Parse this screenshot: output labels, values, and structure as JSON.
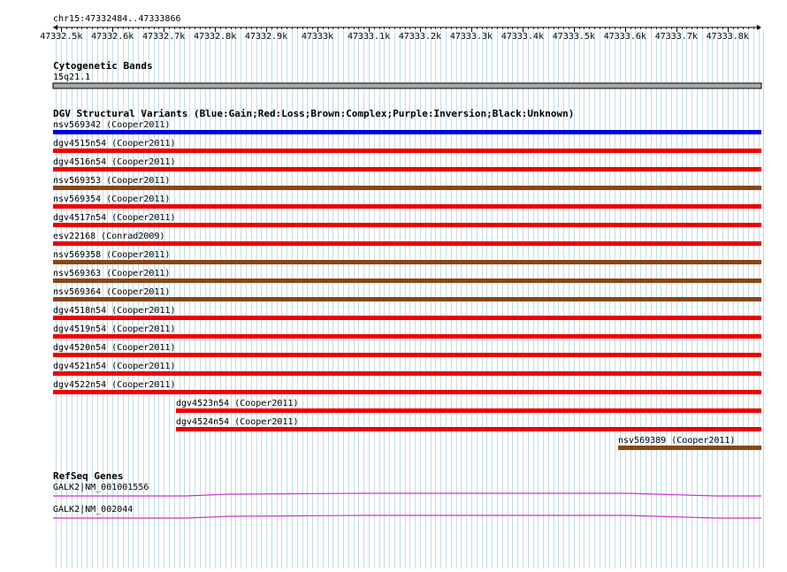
{
  "ruler": {
    "locus": "chr15:47332484..47333866",
    "tick_labels": [
      "47332.5k",
      "47332.6k",
      "47332.7k",
      "47332.8k",
      "47332.9k",
      "47333k",
      "47333.1k",
      "47333.2k",
      "47333.3k",
      "47333.4k",
      "47333.5k",
      "47333.6k",
      "47333.7k",
      "47333.8k"
    ]
  },
  "tracks": {
    "cytoband": {
      "title": "Cytogenetic Bands",
      "band_label": "15q21.1",
      "colors": {
        "band": "#a8a8a8",
        "outline": "#000000"
      }
    },
    "dgv": {
      "title": "DGV Structural Variants (Blue:Gain;Red:Loss;Brown:Complex;Purple:Inversion;Black:Unknown)",
      "colors": {
        "gain": "#0000e0",
        "loss": "#ee0000",
        "complex": "#8b4513"
      },
      "features": [
        {
          "label": "nsv569342 (Cooper2011)",
          "type": "gain",
          "start": 47332484,
          "end": 47333866
        },
        {
          "label": "dgv4515n54 (Cooper2011)",
          "type": "loss",
          "start": 47332484,
          "end": 47333866
        },
        {
          "label": "dgv4516n54 (Cooper2011)",
          "type": "loss",
          "start": 47332484,
          "end": 47333866
        },
        {
          "label": "nsv569353 (Cooper2011)",
          "type": "complex",
          "start": 47332484,
          "end": 47333866
        },
        {
          "label": "nsv569354 (Cooper2011)",
          "type": "loss",
          "start": 47332484,
          "end": 47333866
        },
        {
          "label": "dgv4517n54 (Cooper2011)",
          "type": "loss",
          "start": 47332484,
          "end": 47333866
        },
        {
          "label": "esv22168 (Conrad2009)",
          "type": "loss",
          "start": 47332484,
          "end": 47333866
        },
        {
          "label": "nsv569358 (Cooper2011)",
          "type": "complex",
          "start": 47332484,
          "end": 47333866
        },
        {
          "label": "nsv569363 (Cooper2011)",
          "type": "complex",
          "start": 47332484,
          "end": 47333866
        },
        {
          "label": "nsv569364 (Cooper2011)",
          "type": "complex",
          "start": 47332484,
          "end": 47333866
        },
        {
          "label": "dgv4518n54 (Cooper2011)",
          "type": "loss",
          "start": 47332484,
          "end": 47333866
        },
        {
          "label": "dgv4519n54 (Cooper2011)",
          "type": "loss",
          "start": 47332484,
          "end": 47333866
        },
        {
          "label": "dgv4520n54 (Cooper2011)",
          "type": "loss",
          "start": 47332484,
          "end": 47333866
        },
        {
          "label": "dgv4521n54 (Cooper2011)",
          "type": "loss",
          "start": 47332484,
          "end": 47333866
        },
        {
          "label": "dgv4522n54 (Cooper2011)",
          "type": "loss",
          "start": 47332484,
          "end": 47333866
        },
        {
          "label": "dgv4523n54 (Cooper2011)",
          "type": "loss",
          "start": 47332724,
          "end": 47333866
        },
        {
          "label": "dgv4524n54 (Cooper2011)",
          "type": "loss",
          "start": 47332724,
          "end": 47333866
        },
        {
          "label": "nsv569389 (Cooper2011)",
          "type": "complex",
          "start": 47333587,
          "end": 47333866
        }
      ]
    },
    "refseq": {
      "title": "RefSeq Genes",
      "color": "#cc33cc",
      "genes": [
        {
          "label": "GALK2|NM_001001556"
        },
        {
          "label": "GALK2|NM_002044"
        }
      ]
    }
  }
}
